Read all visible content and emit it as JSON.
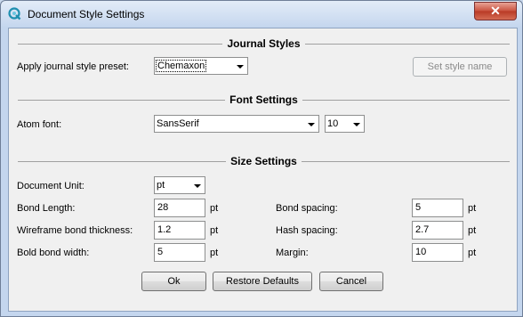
{
  "window": {
    "title": "Document Style Settings",
    "close_glyph": "✕"
  },
  "sections": {
    "journal": "Journal Styles",
    "font": "Font Settings",
    "size": "Size Settings"
  },
  "journal": {
    "preset_label": "Apply journal style preset:",
    "preset_value": "Chemaxon",
    "set_style_name": "Set style name"
  },
  "font": {
    "atom_label": "Atom font:",
    "atom_value": "SansSerif",
    "size_value": "10"
  },
  "size": {
    "unit_label": "Document Unit:",
    "unit_value": "pt",
    "bond_length_label": "Bond Length:",
    "bond_length_value": "28",
    "wireframe_label": "Wireframe bond thickness:",
    "wireframe_value": "1.2",
    "bold_label": "Bold bond width:",
    "bold_value": "5",
    "bond_spacing_label": "Bond spacing:",
    "bond_spacing_value": "5",
    "hash_spacing_label": "Hash spacing:",
    "hash_spacing_value": "2.7",
    "margin_label": "Margin:",
    "margin_value": "10",
    "unit_suffix": "pt"
  },
  "buttons": {
    "ok": "Ok",
    "restore": "Restore Defaults",
    "cancel": "Cancel"
  },
  "icons": {
    "app": "chemaxon-app-icon",
    "close": "close-icon",
    "dropdown": "chevron-down-icon"
  }
}
